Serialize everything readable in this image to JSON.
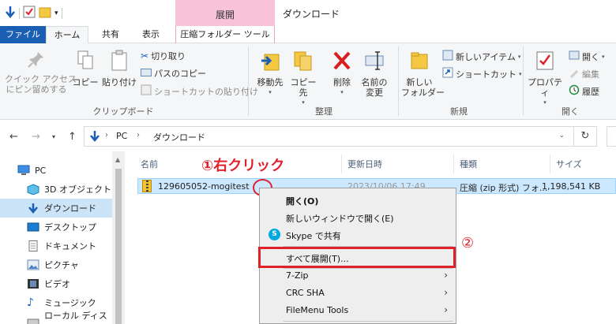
{
  "window": {
    "title": "ダウンロード",
    "context_tab_header": "展開",
    "accent_color": "#1a5fb4",
    "context_color": "#f8c2d8"
  },
  "tabs": [
    "ファイル",
    "ホーム",
    "共有",
    "表示",
    "圧縮フォルダー ツール"
  ],
  "ribbon": {
    "clipboard": {
      "pin": "クイック アクセス\nにピン留めする",
      "copy": "コピー",
      "paste": "貼り付け",
      "cut": "切り取り",
      "copy_path": "パスのコピー",
      "paste_shortcut": "ショートカットの貼り付け",
      "group": "クリップボード"
    },
    "organize": {
      "move_to": "移動先",
      "copy_to": "コピー先",
      "delete": "削除",
      "rename": "名前の\n変更",
      "group": "整理"
    },
    "new": {
      "new_folder": "新しい\nフォルダー",
      "new_item": "新しいアイテム",
      "shortcut": "ショートカット",
      "group": "新規"
    },
    "open": {
      "properties": "プロパティ",
      "open": "開く",
      "edit": "編集",
      "history": "履歴",
      "group": "開く"
    }
  },
  "address": {
    "root": "PC",
    "current": "ダウンロード"
  },
  "nav_items": [
    {
      "label": "PC",
      "icon": "pc-icon"
    },
    {
      "label": "3D オブジェクト",
      "icon": "cube-icon"
    },
    {
      "label": "ダウンロード",
      "icon": "download-icon"
    },
    {
      "label": "デスクトップ",
      "icon": "desktop-icon"
    },
    {
      "label": "ドキュメント",
      "icon": "document-icon"
    },
    {
      "label": "ピクチャ",
      "icon": "picture-icon"
    },
    {
      "label": "ビデオ",
      "icon": "video-icon"
    },
    {
      "label": "ミュージック",
      "icon": "music-icon"
    },
    {
      "label": "ローカル ディスク (C",
      "icon": "disk-icon"
    }
  ],
  "columns": {
    "name": "名前",
    "date": "更新日時",
    "type": "種類",
    "size": "サイズ"
  },
  "file": {
    "name": "129605052-mogitest",
    "date": "2023/10/06 17:49",
    "type": "圧縮 (zip 形式) フォ...",
    "size": "1,198,541 KB"
  },
  "annotations": {
    "step1": "①右クリック",
    "step2": "②"
  },
  "context_menu": {
    "open": "開く(O)",
    "open_new_window": "新しいウィンドウで開く(E)",
    "skype": "Skype で共有",
    "extract_all": "すべて展開(T)...",
    "seven_zip": "7-Zip",
    "crc": "CRC SHA",
    "filemenu": "FileMenu Tools"
  }
}
